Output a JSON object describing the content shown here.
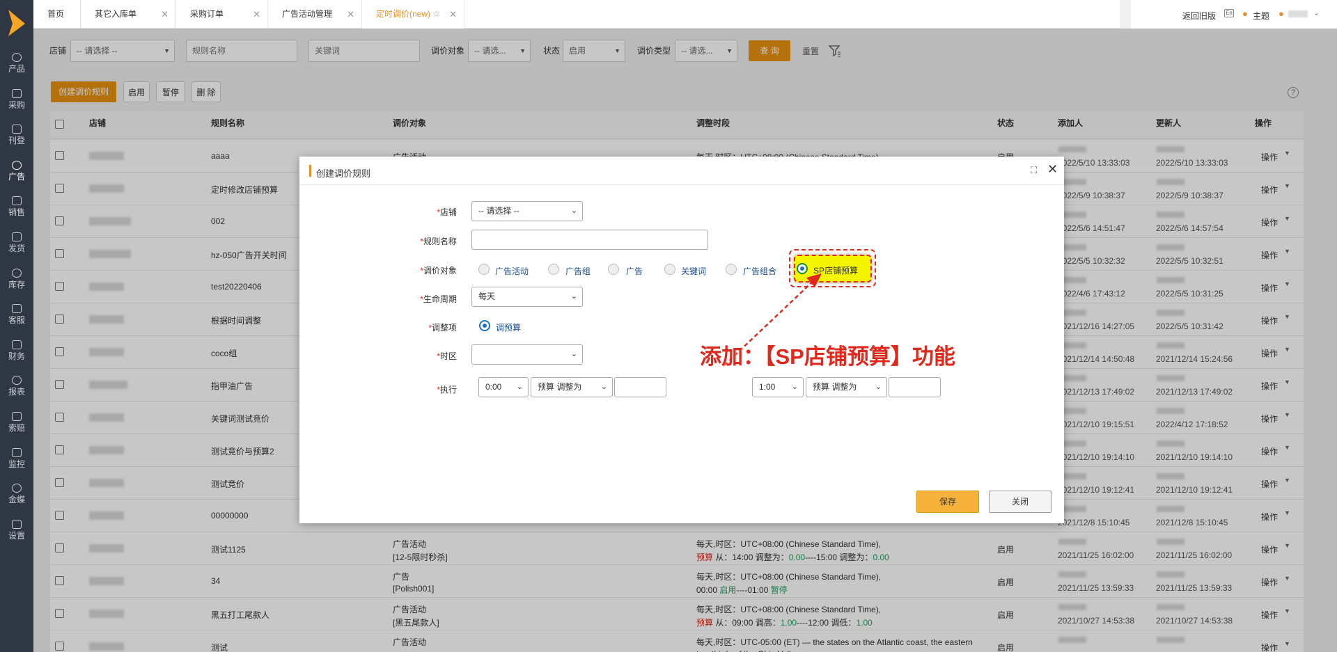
{
  "sidebar": {
    "items": [
      {
        "label": "产品",
        "icon": "lock-icon"
      },
      {
        "label": "采购",
        "icon": "cart-icon"
      },
      {
        "label": "刊登",
        "icon": "upload-icon"
      },
      {
        "label": "广告",
        "icon": "ad-icon"
      },
      {
        "label": "销售",
        "icon": "sales-icon"
      },
      {
        "label": "发货",
        "icon": "truck-icon"
      },
      {
        "label": "库存",
        "icon": "warehouse-icon"
      },
      {
        "label": "客服",
        "icon": "headset-icon"
      },
      {
        "label": "财务",
        "icon": "finance-icon"
      },
      {
        "label": "报表",
        "icon": "report-icon"
      },
      {
        "label": "索赔",
        "icon": "shield-icon"
      },
      {
        "label": "监控",
        "icon": "monitor-icon"
      },
      {
        "label": "金蝶",
        "icon": "kingdee-icon"
      },
      {
        "label": "设置",
        "icon": "gear-icon"
      }
    ]
  },
  "tabs": [
    {
      "label": "首页"
    },
    {
      "label": "其它入库单"
    },
    {
      "label": "采购订单"
    },
    {
      "label": "广告活动管理"
    },
    {
      "label": "定时调价(new)"
    }
  ],
  "topright": {
    "old_version": "返回旧版",
    "theme": "主题"
  },
  "filters": {
    "shop_label": "店铺",
    "shop_value": "-- 请选择 --",
    "rule_name_placeholder": "规则名称",
    "keyword_placeholder": "关键词",
    "target_label": "调价对象",
    "target_value": "-- 请选...",
    "status_label": "状态",
    "status_value": "启用",
    "type_label": "调价类型",
    "type_value": "-- 请选...",
    "query": "查 询",
    "reset": "重置"
  },
  "toolbar": {
    "create": "创建调价规则",
    "enable": "启用",
    "pause": "暂停",
    "delete": "删 除"
  },
  "table": {
    "headers": [
      "店铺",
      "规则名称",
      "调价对象",
      "调整时段",
      "状态",
      "添加人",
      "更新人",
      "操作"
    ],
    "action_label": "操作",
    "rows": [
      {
        "name": "aaaa",
        "target": "广告活动",
        "target_sub": "",
        "period": "每天,时区：UTC+08:00 (Chinese Standard Time),",
        "period2": "",
        "status": "启用",
        "added": "2022/5/10 13:33:03",
        "updated": "2022/5/10 13:33:03"
      },
      {
        "name": "定时修改店铺预算",
        "target": "",
        "target_sub": "",
        "period": "",
        "period2": "",
        "status": "",
        "added": "2022/5/9 10:38:37",
        "updated": "2022/5/9 10:38:37"
      },
      {
        "name": "002",
        "target": "",
        "target_sub": "",
        "period": "",
        "period2": "",
        "status": "",
        "added": "2022/5/6 14:51:47",
        "updated": "2022/5/6 14:57:54"
      },
      {
        "name": "hz-050广告开关时间",
        "target": "",
        "target_sub": "",
        "period": "",
        "period2": "",
        "status": "",
        "added": "2022/5/5 10:32:32",
        "updated": "2022/5/5 10:32:51"
      },
      {
        "name": "test20220406",
        "target": "",
        "target_sub": "",
        "period": "",
        "period2": "",
        "status": "",
        "added": "2022/4/6 17:43:12",
        "updated": "2022/5/5 10:31:25"
      },
      {
        "name": "根据时间调整",
        "target": "",
        "target_sub": "",
        "period": "",
        "period2": "",
        "status": "",
        "added": "2021/12/16 14:27:05",
        "updated": "2022/5/5 10:31:42"
      },
      {
        "name": "coco组",
        "target": "",
        "target_sub": "",
        "period": "",
        "period2": "",
        "status": "",
        "added": "2021/12/14 14:50:48",
        "updated": "2021/12/14 15:24:56"
      },
      {
        "name": "指甲油广告",
        "target": "",
        "target_sub": "",
        "period": "",
        "period2": "",
        "status": "",
        "added": "2021/12/13 17:49:02",
        "updated": "2021/12/13 17:49:02"
      },
      {
        "name": "关键词测试竞价",
        "target": "",
        "target_sub": "",
        "period": "",
        "period2": "",
        "status": "",
        "added": "2021/12/10 19:15:51",
        "updated": "2022/4/12 17:18:52"
      },
      {
        "name": "测试竞价与预算2",
        "target": "",
        "target_sub": "",
        "period": "",
        "period2": "",
        "status": "",
        "added": "2021/12/10 19:14:10",
        "updated": "2021/12/10 19:14:10"
      },
      {
        "name": "测试竞价",
        "target": "",
        "target_sub": "",
        "period": "",
        "period2": "",
        "status": "",
        "added": "2021/12/10 19:12:41",
        "updated": "2021/12/10 19:12:41"
      },
      {
        "name": "00000000",
        "target": "",
        "target_sub": "",
        "period": "",
        "period2": "",
        "status": "",
        "added": "2021/12/8 15:10:45",
        "updated": "2021/12/8 15:10:45"
      },
      {
        "name": "测试1125",
        "target": "广告活动",
        "target_sub": "[12-5限时秒杀]",
        "period": "每天,时区：UTC+08:00 (Chinese Standard Time),",
        "period2": "预算 从：14:00 调整为：0.00----15:00 调整为：0.00",
        "status": "启用",
        "added": "2021/11/25 16:02:00",
        "updated": "2021/11/25 16:02:00"
      },
      {
        "name": "34",
        "target": "广告",
        "target_sub": "[Polish001]",
        "period": "每天,时区：UTC+08:00 (Chinese Standard Time),",
        "period2": "00:00 启用----01:00 暂停",
        "status": "启用",
        "added": "2021/11/25 13:59:33",
        "updated": "2021/11/25 13:59:33"
      },
      {
        "name": "黑五打工尾款人",
        "target": "广告活动",
        "target_sub": "[黑五尾款人]",
        "period": "每天,时区：UTC+08:00 (Chinese Standard Time),",
        "period2": "预算 从：09:00 调高：1.00----12:00 调低：1.00",
        "status": "启用",
        "added": "2021/10/27 14:53:38",
        "updated": "2021/10/27 14:53:38"
      },
      {
        "name": "测试",
        "target": "广告活动",
        "target_sub": "",
        "period": "每天,时区：UTC-05:00 (ET) — the states on the Atlantic coast, the eastern",
        "period2": "two thirds of the Ohio Valley",
        "status": "启用",
        "added": "",
        "updated": ""
      }
    ]
  },
  "modal": {
    "title": "创建调价规则",
    "shop_label": "店铺",
    "shop_value": "-- 请选择 --",
    "rule_name_label": "规则名称",
    "target_label": "调价对象",
    "targets": [
      "广告活动",
      "广告组",
      "广告",
      "关键词",
      "广告组合",
      "SP店铺预算"
    ],
    "lifecycle_label": "生命周期",
    "lifecycle_value": "每天",
    "adjust_label": "调整项",
    "adjust_option": "调预算",
    "timezone_label": "时区",
    "timezone_value": "",
    "exec_label": "执行",
    "exec1_time": "0:00",
    "exec1_action": "预算 调整为",
    "exec2_time": "1:00",
    "exec2_action": "预算 调整为",
    "save": "保存",
    "close": "关闭"
  },
  "annotation": {
    "text": "添加：【SP店铺预算】功能",
    "color": "#e0281c",
    "highlight": "#f5f500"
  }
}
